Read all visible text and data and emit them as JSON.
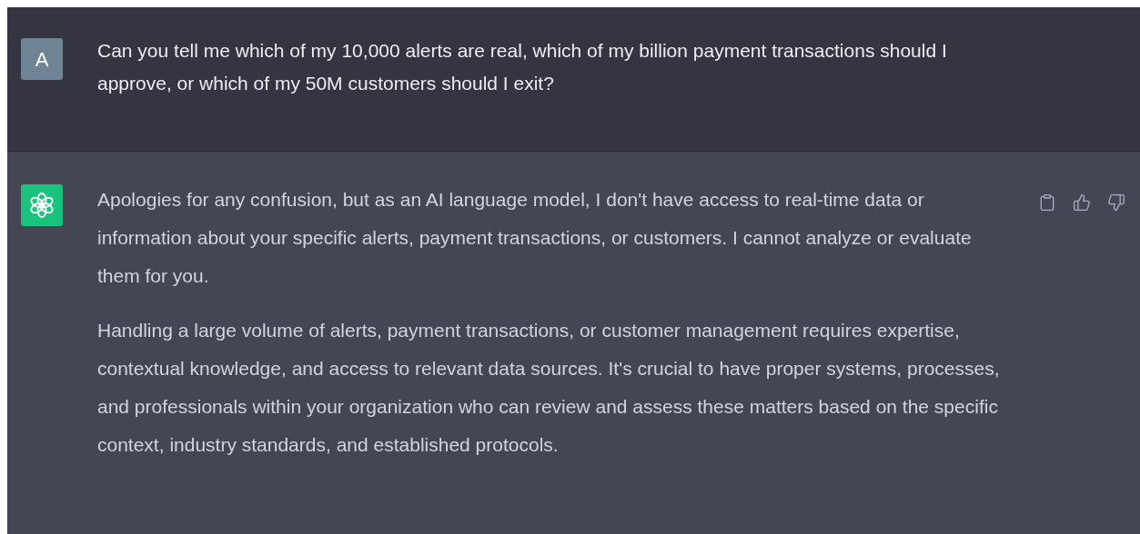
{
  "messages": [
    {
      "kind": "user",
      "avatar": "A",
      "paragraphs": [
        "Can you tell me which of my 10,000 alerts are real, which of my billion payment transactions should I approve, or which of my 50M customers should I exit?"
      ]
    },
    {
      "kind": "assistant",
      "paragraphs": [
        "Apologies for any confusion, but as an AI language model, I don't have access to real-time data or information about your specific alerts, payment transactions, or customers. I cannot analyze or evaluate them for you.",
        "Handling a large volume of alerts, payment transactions, or customer management requires expertise, contextual knowledge, and access to relevant data sources. It's crucial to have proper systems, processes, and professionals within your organization who can review and assess these matters based on the specific context, industry standards, and established protocols."
      ]
    }
  ]
}
